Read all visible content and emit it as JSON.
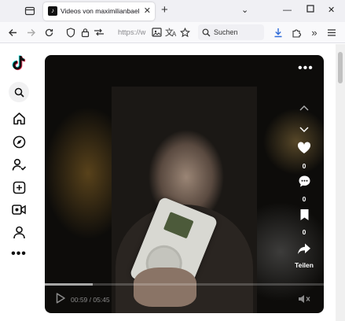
{
  "browser": {
    "tab_title": "Videos von maximilianbaehring",
    "url_text": "https://w",
    "search_placeholder": "Suchen"
  },
  "video": {
    "current_time": "00:59",
    "duration": "05:45",
    "time_display": "00:59 / 05:45",
    "progress_fraction": 0.171,
    "like_count": "0",
    "comment_count": "0",
    "bookmark_count": "0",
    "share_label": "Teilen"
  },
  "icons": {
    "sidebar": [
      "tiktok-logo",
      "search",
      "home",
      "explore",
      "following",
      "upload",
      "live",
      "profile",
      "more"
    ],
    "toolbar": [
      "back",
      "forward",
      "reload",
      "shield",
      "lock",
      "permissions",
      "reader",
      "translate",
      "bookmark-star",
      "download",
      "extensions",
      "overflow",
      "menu"
    ]
  }
}
